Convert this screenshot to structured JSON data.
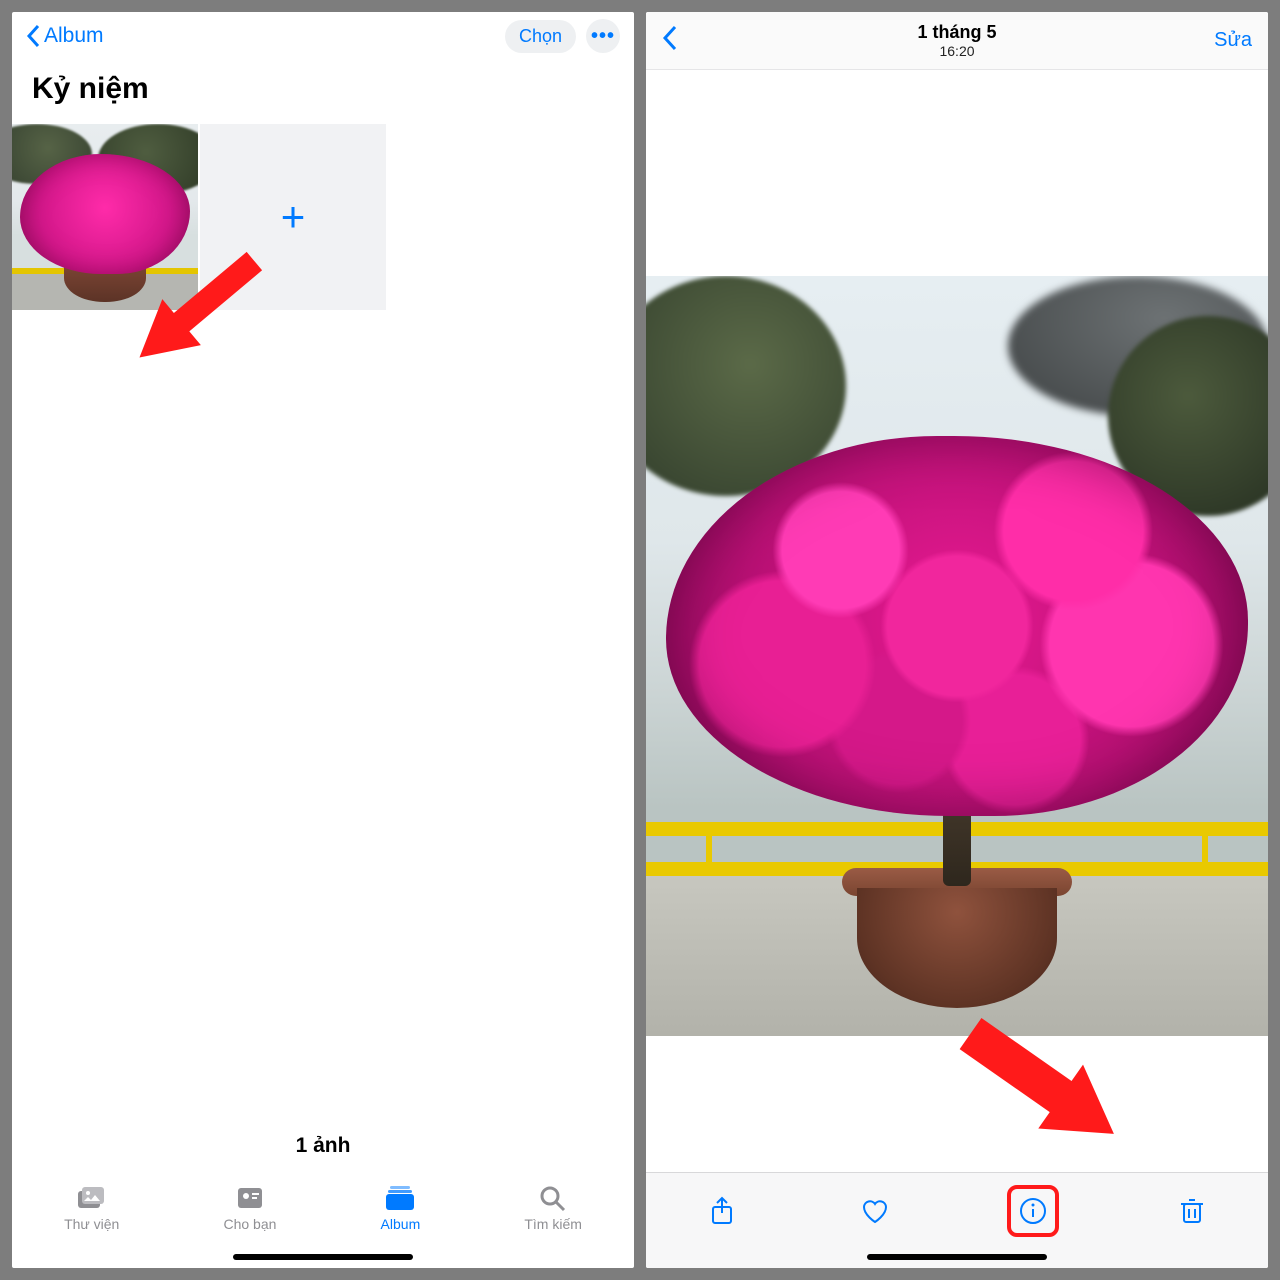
{
  "left": {
    "back_label": "Album",
    "select_label": "Chọn",
    "title": "Kỷ niệm",
    "count_label": "1 ảnh",
    "tabs": {
      "library": "Thư viện",
      "for_you": "Cho bạn",
      "album": "Album",
      "search": "Tìm kiếm"
    }
  },
  "right": {
    "date": "1 tháng 5",
    "time": "16:20",
    "edit_label": "Sửa"
  }
}
